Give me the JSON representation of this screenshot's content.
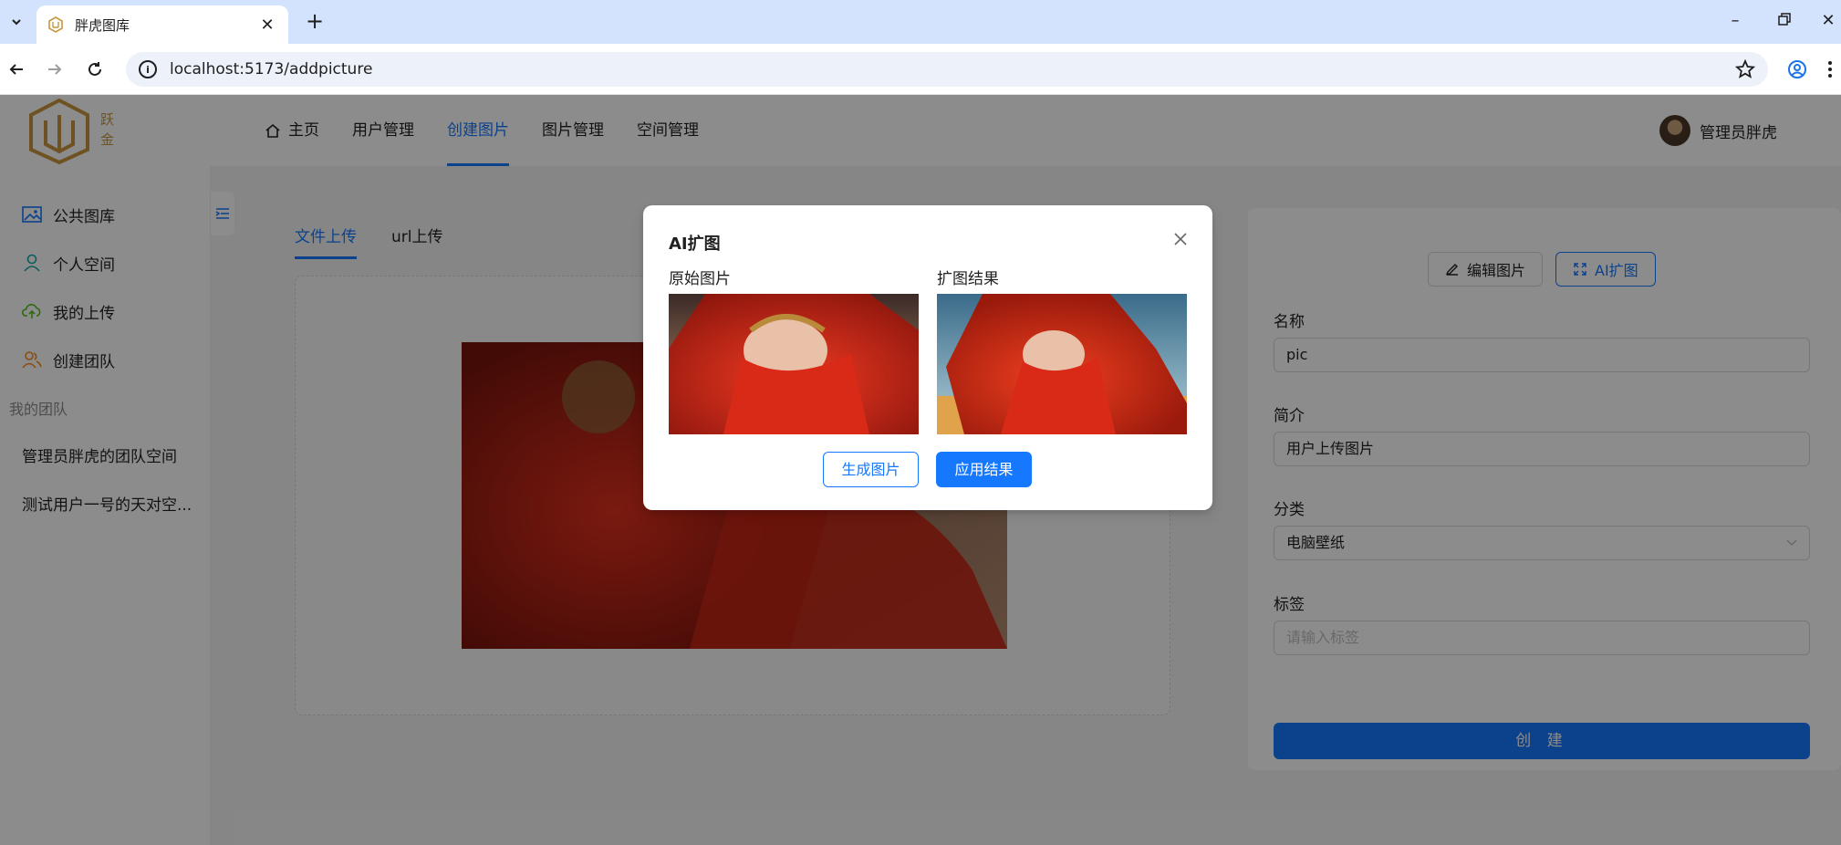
{
  "browser": {
    "tab_title": "胖虎图库",
    "url": "localhost:5173/addpicture"
  },
  "header": {
    "logo_text": [
      "跃",
      "金"
    ],
    "nav": [
      {
        "label": "主页",
        "active": false
      },
      {
        "label": "用户管理",
        "active": false
      },
      {
        "label": "创建图片",
        "active": true
      },
      {
        "label": "图片管理",
        "active": false
      },
      {
        "label": "空间管理",
        "active": false
      }
    ],
    "user_name": "管理员胖虎"
  },
  "sidebar": {
    "items": [
      {
        "label": "公共图库",
        "icon": "picture-icon"
      },
      {
        "label": "个人空间",
        "icon": "user-icon"
      },
      {
        "label": "我的上传",
        "icon": "cloud-upload-icon"
      },
      {
        "label": "创建团队",
        "icon": "team-icon"
      }
    ],
    "group_title": "我的团队",
    "teams": [
      "管理员胖虎的团队空间",
      "测试用户一号的天对空..."
    ]
  },
  "upload": {
    "tabs": [
      {
        "label": "文件上传",
        "active": true
      },
      {
        "label": "url上传",
        "active": false
      }
    ]
  },
  "form": {
    "edit_button": "编辑图片",
    "ai_button": "AI扩图",
    "name_label": "名称",
    "name_value": "pic",
    "intro_label": "简介",
    "intro_value": "用户上传图片",
    "category_label": "分类",
    "category_value": "电脑壁纸",
    "tags_label": "标签",
    "tags_placeholder": "请输入标签",
    "submit": "创 建"
  },
  "modal": {
    "title": "AI扩图",
    "original_label": "原始图片",
    "result_label": "扩图结果",
    "generate_button": "生成图片",
    "apply_button": "应用结果"
  },
  "colors": {
    "primary": "#1677ff",
    "tabstrip": "#d3e3fd"
  }
}
